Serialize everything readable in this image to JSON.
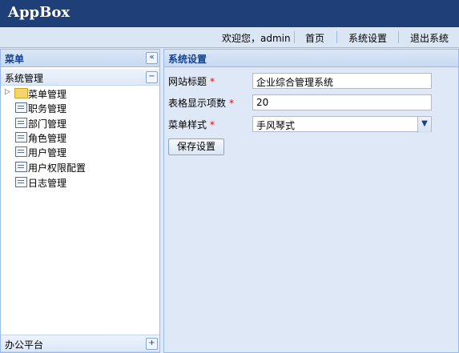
{
  "app": {
    "title": "AppBox"
  },
  "userbar": {
    "welcome": "欢迎您，admin",
    "home": "首页",
    "settings": "系统设置",
    "logout": "退出系统"
  },
  "sidebar": {
    "title": "菜单",
    "collapse_icon": "double-chevron-left-icon",
    "sections": [
      {
        "label": "系统管理",
        "state": "expanded"
      },
      {
        "label": "办公平台",
        "state": "collapsed"
      }
    ],
    "tree": [
      {
        "label": "菜单管理",
        "icon": "folder-icon",
        "expandable": true
      },
      {
        "label": "职务管理",
        "icon": "page-icon"
      },
      {
        "label": "部门管理",
        "icon": "page-icon"
      },
      {
        "label": "角色管理",
        "icon": "page-icon"
      },
      {
        "label": "用户管理",
        "icon": "page-icon"
      },
      {
        "label": "用户权限配置",
        "icon": "page-icon"
      },
      {
        "label": "日志管理",
        "icon": "page-icon"
      }
    ]
  },
  "main": {
    "title": "系统设置",
    "fields": {
      "site_title": {
        "label": "网站标题",
        "value": "企业综合管理系统"
      },
      "page_size": {
        "label": "表格显示项数",
        "value": "20"
      },
      "menu_style": {
        "label": "菜单样式",
        "value": "手风琴式"
      }
    },
    "required_mark": "*",
    "save_label": "保存设置"
  },
  "colors": {
    "header": "#1e3f78",
    "panel_title": "#15428b",
    "border": "#99bbe8",
    "required": "#ee0000"
  }
}
